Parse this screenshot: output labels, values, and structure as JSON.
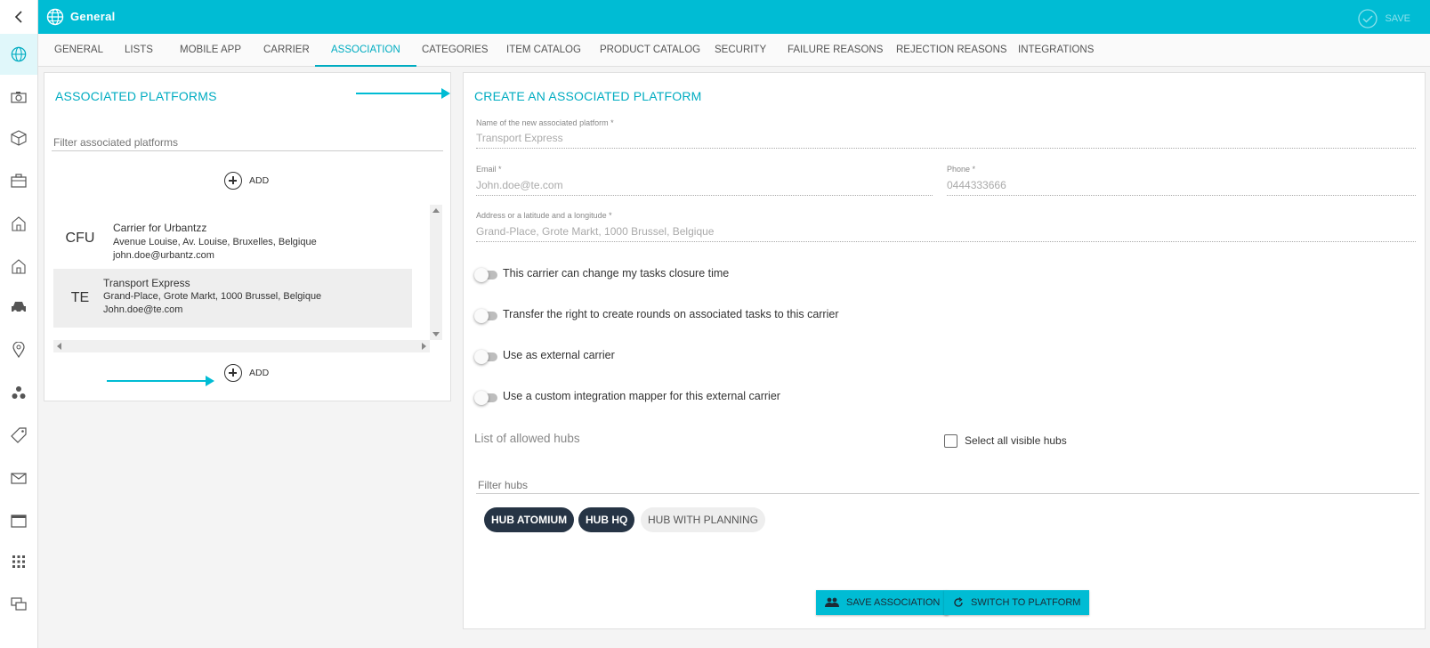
{
  "header": {
    "title": "General",
    "save_label": "SAVE"
  },
  "sidebar": {
    "items": [
      "globe-icon",
      "camera-icon",
      "cube-icon",
      "briefcase-icon",
      "house-icon",
      "house-icon",
      "car-icon",
      "location-pin-icon",
      "biohazard-icon",
      "tag-icon",
      "envelope-icon",
      "calendar-icon",
      "apps-grid-icon",
      "chat-icon"
    ]
  },
  "tabs": [
    {
      "label": "GENERAL"
    },
    {
      "label": "LISTS"
    },
    {
      "label": "MOBILE APP"
    },
    {
      "label": "CARRIER"
    },
    {
      "label": "ASSOCIATION"
    },
    {
      "label": "CATEGORIES"
    },
    {
      "label": "ITEM CATALOG"
    },
    {
      "label": "PRODUCT CATALOG"
    },
    {
      "label": "SECURITY"
    },
    {
      "label": "FAILURE REASONS"
    },
    {
      "label": "REJECTION REASONS"
    },
    {
      "label": "INTEGRATIONS"
    }
  ],
  "active_tab": "ASSOCIATION",
  "left": {
    "title": "ASSOCIATED PLATFORMS",
    "filter_placeholder": "Filter associated platforms",
    "add_label": "ADD",
    "items": [
      {
        "abbr": "CFU",
        "name": "Carrier for Urbantzz",
        "address": "Avenue Louise, Av. Louise, Bruxelles, Belgique",
        "email": "john.doe@urbantz.com"
      },
      {
        "abbr": "TE",
        "name": "Transport Express",
        "address": "Grand-Place, Grote Markt, 1000 Brussel, Belgique",
        "email": "John.doe@te.com"
      }
    ]
  },
  "right": {
    "title": "CREATE AN ASSOCIATED PLATFORM",
    "name_label": "Name of the new associated platform *",
    "name_value": "Transport Express",
    "email_label": "Email *",
    "email_value": "John.doe@te.com",
    "phone_label": "Phone *",
    "phone_value": "0444333666",
    "address_label": "Address or a latitude and a longitude *",
    "address_value": "Grand-Place, Grote Markt, 1000 Brussel, Belgique",
    "toggles": [
      "This carrier can change my tasks closure time",
      "Transfer the right to create rounds on associated tasks to this carrier",
      "Use as external carrier",
      "Use a custom integration mapper for this external carrier"
    ],
    "hubs_label": "List of allowed hubs",
    "select_all_label": "Select all visible hubs",
    "filter_hubs_placeholder": "Filter hubs",
    "hubs": [
      "HUB ATOMIUM",
      "HUB HQ",
      "HUB WITH PLANNING"
    ],
    "save_association_label": "SAVE ASSOCIATION",
    "switch_platform_label": "SWITCH TO PLATFORM"
  },
  "colors": {
    "accent": "#00bcd4",
    "chip_dark": "#263445"
  }
}
